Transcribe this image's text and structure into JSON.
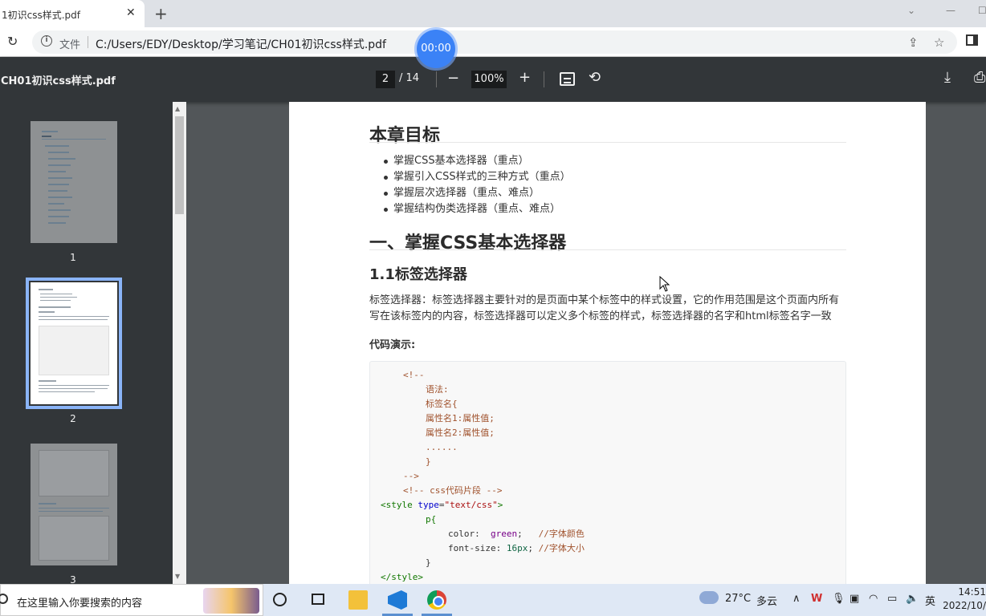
{
  "browser": {
    "tab_title": "1初识css样式.pdf",
    "tab_close": "✕",
    "new_tab": "+",
    "file_label": "文件",
    "url": "C:/Users/EDY/Desktop/学习笔记/CH01初识css样式.pdf",
    "timer": "00:00"
  },
  "pdf_toolbar": {
    "doc_title": "CH01初识css样式.pdf",
    "current_page": "2",
    "total_pages": "/ 14",
    "zoom": "100%",
    "zoom_out": "−",
    "zoom_in": "+"
  },
  "thumbnails": [
    {
      "label": "1"
    },
    {
      "label": "2"
    },
    {
      "label": "3"
    }
  ],
  "page": {
    "heading_goals": "本章目标",
    "goals": [
      "掌握CSS基本选择器（重点）",
      "掌握引入CSS样式的三种方式（重点）",
      "掌握层次选择器（重点、难点）",
      "掌握结构伪类选择器（重点、难点）"
    ],
    "heading_section1": "一、掌握CSS基本选择器",
    "heading_11": "1.1标签选择器",
    "para_line1": "标签选择器：标签选择器主要针对的是页面中某个标签中的样式设置，它的作用范围是这个页面内所有",
    "para_line2": "写在该标签内的内容，标签选择器可以定义多个标签的样式，标签选择器的名字和html标签名字一致",
    "code_label": "代码演示:",
    "code": {
      "l1": "<!--",
      "l2": "语法:",
      "l3": "标签名{",
      "l4": "属性名1:属性值;",
      "l5": "属性名2:属性值;",
      "l6": "......",
      "l7": "}",
      "l8": "-->",
      "l9": "<!-- css代码片段 -->",
      "l10_tag": "<style",
      "l10_attr": "type",
      "l10_eq": "=",
      "l10_str": "\"text/css\"",
      "l10_end": ">",
      "l11": "p{",
      "l12_prop": "color",
      "l12_colon": ":",
      "l12_val": "green",
      "l12_semi": ";",
      "l12_cmt": "//字体颜色",
      "l13_prop": "font-size",
      "l13_colon": ":",
      "l13_val": "16px",
      "l13_semi": ";",
      "l13_cmt": "//字体大小",
      "l14": "}",
      "l15": "</style>"
    }
  },
  "taskbar": {
    "search_placeholder": "在这里输入你要搜索的内容",
    "weather_temp": "27°C",
    "weather_desc": "多云",
    "ime": "英",
    "time": "14:51",
    "date": "2022/10/"
  },
  "colors": {
    "pdf_toolbar_bg": "#323639",
    "viewer_bg": "#525659",
    "active_thumb_border": "#8ab4f8",
    "timer_bg": "#3b82f6"
  },
  "icons": [
    "info-icon",
    "reload-icon",
    "share-icon",
    "star-icon",
    "side-panel-icon",
    "zoom-out-icon",
    "zoom-in-icon",
    "fit-page-icon",
    "rotate-icon",
    "download-icon",
    "print-icon",
    "search-icon",
    "cortana-icon",
    "task-view-icon",
    "file-explorer-icon",
    "vscode-icon",
    "chrome-icon",
    "weather-cloud-icon",
    "wps-icon",
    "microphone-icon",
    "network-icon",
    "volume-icon"
  ]
}
